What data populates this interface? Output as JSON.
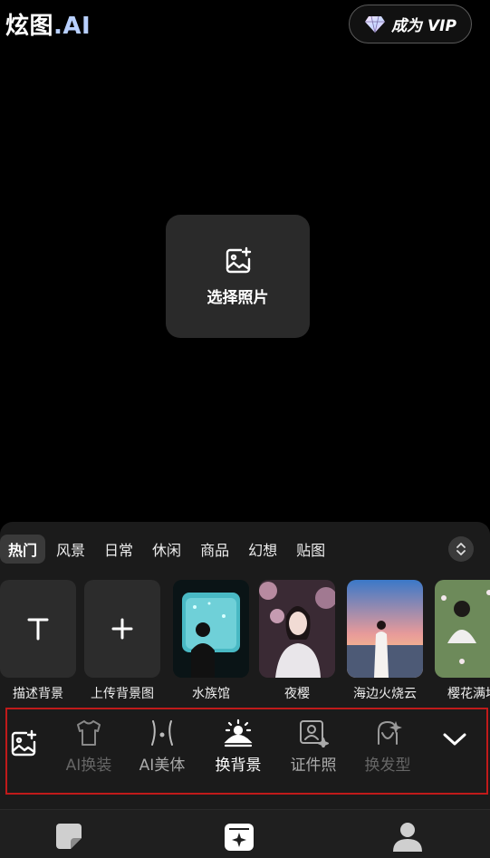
{
  "header": {
    "logo_main": "炫图",
    "logo_ai": ".AI",
    "vip_label": "成为 VIP"
  },
  "canvas": {
    "choose_label": "选择照片"
  },
  "categories": [
    {
      "label": "热门",
      "active": true
    },
    {
      "label": "风景"
    },
    {
      "label": "日常"
    },
    {
      "label": "休闲"
    },
    {
      "label": "商品"
    },
    {
      "label": "幻想"
    },
    {
      "label": "贴图"
    }
  ],
  "backgrounds": [
    {
      "label": "描述背景",
      "icon": "text-T-icon"
    },
    {
      "label": "上传背景图",
      "icon": "plus-icon"
    },
    {
      "label": "水族馆",
      "icon": "aquarium-photo"
    },
    {
      "label": "夜樱",
      "icon": "night-sakura-photo"
    },
    {
      "label": "海边火烧云",
      "icon": "seaside-sunset-photo"
    },
    {
      "label": "樱花满地",
      "icon": "sakura-ground-photo"
    }
  ],
  "tools": [
    {
      "label": "",
      "icon": "add-photo-icon"
    },
    {
      "label": "AI换装",
      "icon": "shirt-icon"
    },
    {
      "label": "AI美体",
      "icon": "body-icon"
    },
    {
      "label": "换背景",
      "icon": "background-icon"
    },
    {
      "label": "证件照",
      "icon": "id-photo-icon"
    },
    {
      "label": "换发型",
      "icon": "hairstyle-icon"
    },
    {
      "label": "",
      "icon": "chevron-down-icon"
    }
  ],
  "colors": {
    "background": "#000000",
    "panel": "#1b1b1b",
    "highlight_border": "#c01a1a",
    "logo_ai": "#b8d0ff"
  }
}
